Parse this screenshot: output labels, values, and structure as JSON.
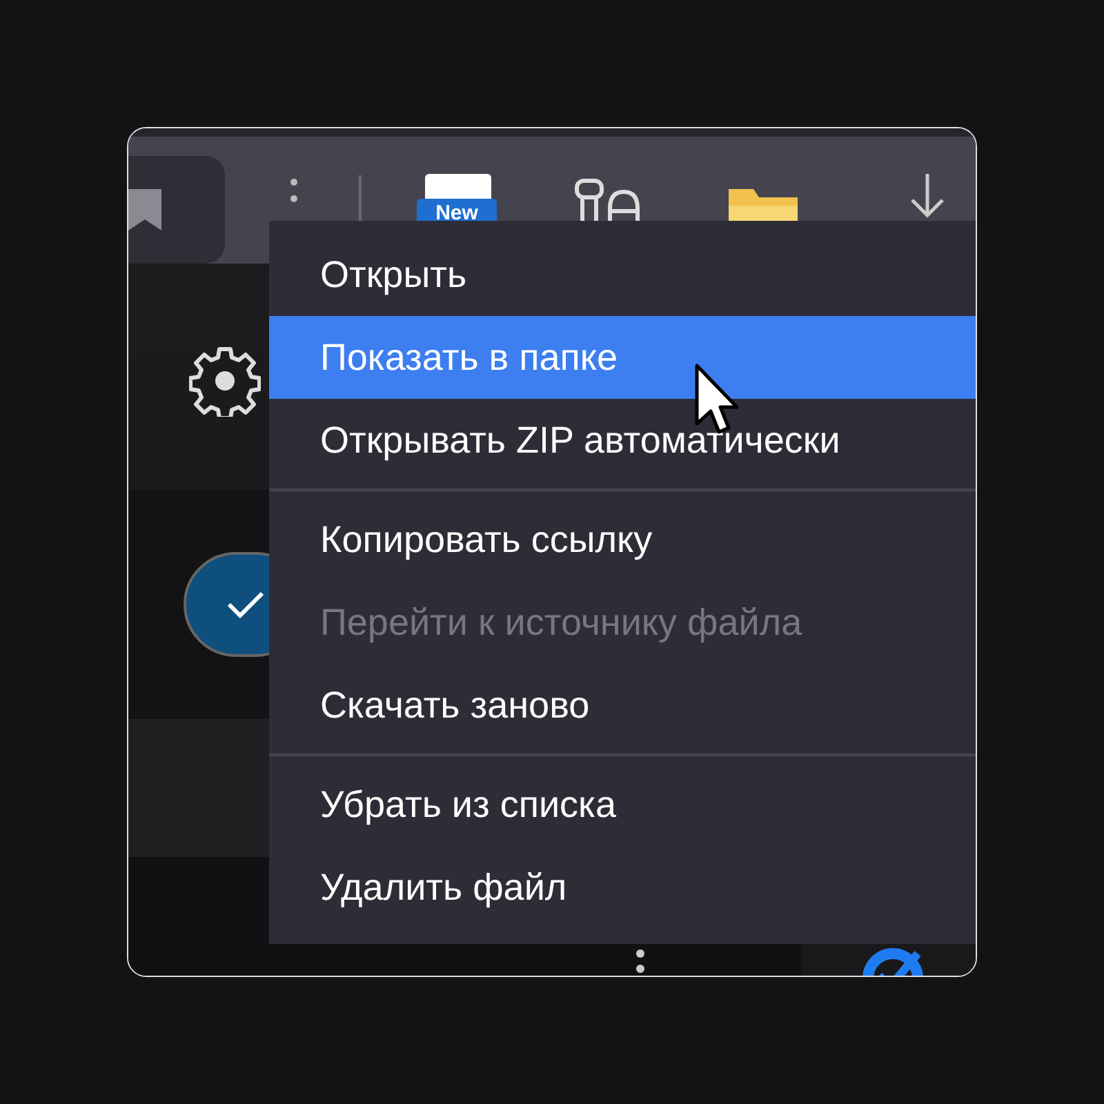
{
  "toolbar": {
    "new_badge": "New"
  },
  "context_menu": {
    "groups": [
      [
        {
          "label": "Открыть",
          "selected": false,
          "disabled": false
        },
        {
          "label": "Показать в папке",
          "selected": true,
          "disabled": false
        },
        {
          "label": "Открывать ZIP автоматически",
          "selected": false,
          "disabled": false
        }
      ],
      [
        {
          "label": "Копировать ссылку",
          "selected": false,
          "disabled": false
        },
        {
          "label": "Перейти к источнику файла",
          "selected": false,
          "disabled": true
        },
        {
          "label": "Скачать заново",
          "selected": false,
          "disabled": false
        }
      ],
      [
        {
          "label": "Убрать из списка",
          "selected": false,
          "disabled": false
        },
        {
          "label": "Удалить файл",
          "selected": false,
          "disabled": false
        }
      ]
    ]
  },
  "download_item": {
    "checked": true
  }
}
